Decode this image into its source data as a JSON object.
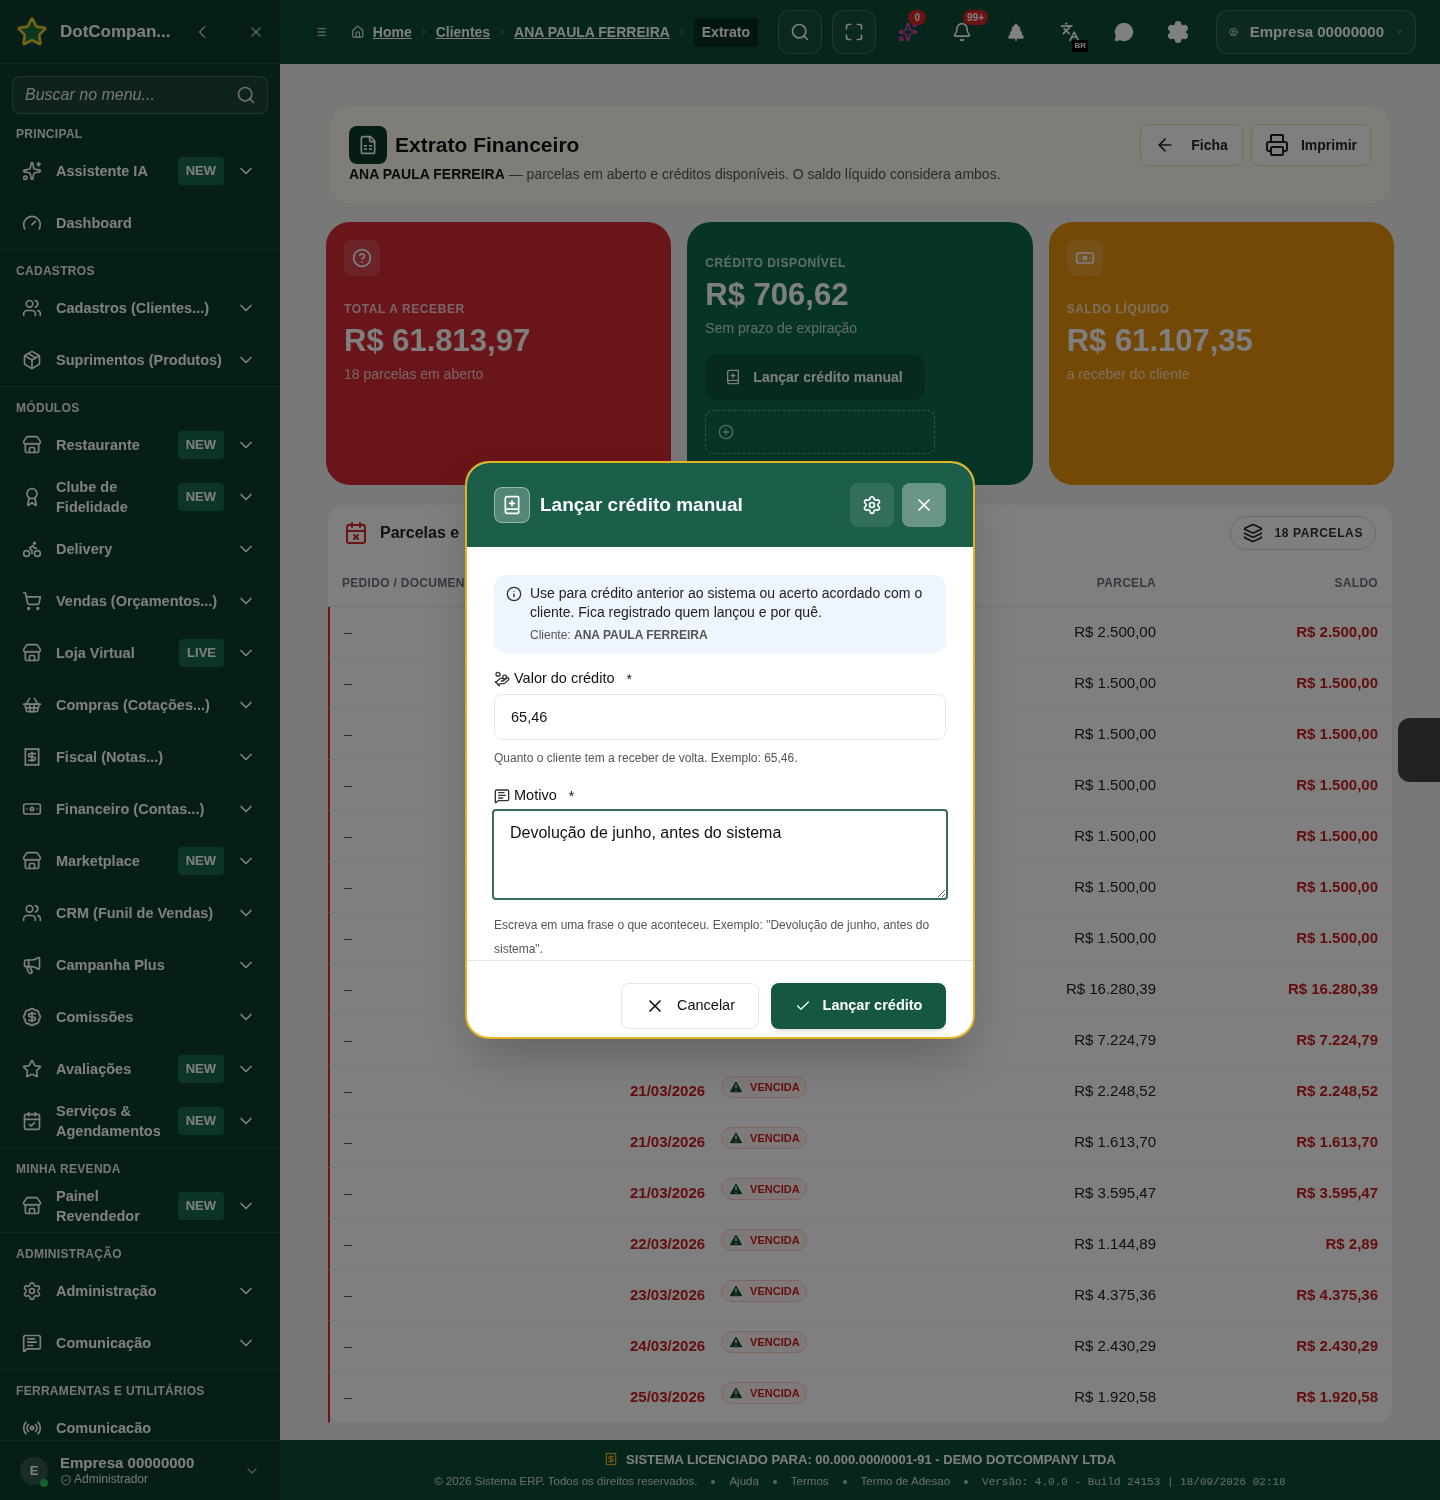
{
  "sidebar": {
    "brand": "DotCompan...",
    "search": {
      "placeholder": "Buscar no menu..."
    },
    "sections": [
      {
        "title": "PRINCIPAL",
        "items": [
          {
            "label": "Assistente IA",
            "badge": "NEW",
            "expandable": true
          },
          {
            "label": "Dashboard",
            "expandable": false
          }
        ]
      },
      {
        "title": "CADASTROS",
        "items": [
          {
            "label": "Cadastros (Clientes...)",
            "expandable": true
          },
          {
            "label": "Suprimentos (Produtos)",
            "expandable": true
          }
        ]
      },
      {
        "title": "MÓDULOS",
        "items": [
          {
            "label": "Restaurante",
            "badge": "NEW",
            "expandable": true
          },
          {
            "label": "Clube de Fidelidade",
            "badge": "NEW",
            "expandable": true
          },
          {
            "label": "Delivery",
            "expandable": true
          },
          {
            "label": "Vendas (Orçamentos...)",
            "expandable": true
          },
          {
            "label": "Loja Virtual",
            "badge": "LIVE",
            "expandable": true
          },
          {
            "label": "Compras (Cotações...)",
            "expandable": true
          },
          {
            "label": "Fiscal (Notas...)",
            "expandable": true
          },
          {
            "label": "Financeiro (Contas...)",
            "expandable": true
          },
          {
            "label": "Marketplace",
            "badge": "NEW",
            "expandable": true
          },
          {
            "label": "CRM (Funil de Vendas)",
            "expandable": true
          },
          {
            "label": "Campanha Plus",
            "expandable": true
          },
          {
            "label": "Comissões",
            "expandable": true
          },
          {
            "label": "Avaliações",
            "badge": "NEW",
            "expandable": true
          },
          {
            "label": "Serviços & Agendamentos",
            "badge": "NEW",
            "expandable": true
          }
        ]
      },
      {
        "title": "MINHA REVENDA",
        "items": [
          {
            "label": "Painel Revendedor",
            "badge": "NEW",
            "expandable": true
          }
        ]
      },
      {
        "title": "ADMINISTRAÇÃO",
        "items": [
          {
            "label": "Administração",
            "expandable": true
          },
          {
            "label": "Comunicação",
            "expandable": true
          }
        ]
      },
      {
        "title": "FERRAMENTAS E UTILITÁRIOS",
        "items": [
          {
            "label": "Comunicacão",
            "expandable": false
          }
        ]
      }
    ],
    "user": {
      "initial": "E",
      "name": "Empresa 00000000",
      "role": "Administrador"
    }
  },
  "topbar": {
    "breadcrumb": [
      {
        "label": "Home",
        "selected": false
      },
      {
        "label": "Clientes",
        "selected": false
      },
      {
        "label": "ANA PAULA FERREIRA",
        "selected": false
      },
      {
        "label": "Extrato",
        "selected": true
      }
    ],
    "ai_badge": "0",
    "notifications_badge": "99+",
    "language_badge": "BR",
    "account": "Empresa 00000000"
  },
  "page_header": {
    "title": "Extrato Financeiro",
    "client": "ANA PAULA FERREIRA",
    "subtitle": "— parcelas em aberto e créditos disponíveis. O saldo líquido considera ambos.",
    "buttons": [
      "Ficha",
      "Imprimir"
    ]
  },
  "cards": [
    {
      "kind": "receivable",
      "label": "TOTAL A RECEBER",
      "value": "R$ 61.813,97",
      "note": "18 parcelas em aberto"
    },
    {
      "kind": "credit",
      "label": "CRÉDITO DISPONÍVEL",
      "value": "R$ 706,62",
      "note": "Sem prazo de expiração",
      "action": "Lançar crédito manual"
    },
    {
      "kind": "net",
      "label": "SALDO LÍQUIDO",
      "value": "R$ 61.107,35",
      "note": "a receber do cliente"
    }
  ],
  "table": {
    "title": "Parcelas e",
    "count": "18 PARCELAS",
    "columns": [
      "PEDIDO / DOCUMEN",
      "PARCELA",
      "SALDO"
    ],
    "rows": [
      {
        "document": "–",
        "installment": "R$ 2.500,00",
        "balance": "R$ 2.500,00"
      },
      {
        "document": "–",
        "installment": "R$ 1.500,00",
        "balance": "R$ 1.500,00"
      },
      {
        "document": "–",
        "installment": "R$ 1.500,00",
        "balance": "R$ 1.500,00"
      },
      {
        "document": "–",
        "installment": "R$ 1.500,00",
        "balance": "R$ 1.500,00"
      },
      {
        "document": "–",
        "installment": "R$ 1.500,00",
        "balance": "R$ 1.500,00"
      },
      {
        "document": "–",
        "installment": "R$ 1.500,00",
        "balance": "R$ 1.500,00"
      },
      {
        "document": "–",
        "installment": "R$ 1.500,00",
        "balance": "R$ 1.500,00"
      },
      {
        "document": "–",
        "installment": "R$ 16.280,39",
        "balance": "R$ 16.280,39"
      },
      {
        "document": "–",
        "installment": "R$ 7.224,79",
        "balance": "R$ 7.224,79"
      },
      {
        "document": "–",
        "date": "21/03/2026",
        "status": "VENCIDA",
        "installment": "R$ 2.248,52",
        "balance": "R$ 2.248,52"
      },
      {
        "document": "–",
        "date": "21/03/2026",
        "status": "VENCIDA",
        "installment": "R$ 1.613,70",
        "balance": "R$ 1.613,70"
      },
      {
        "document": "–",
        "date": "21/03/2026",
        "status": "VENCIDA",
        "installment": "R$ 3.595,47",
        "balance": "R$ 3.595,47"
      },
      {
        "document": "–",
        "date": "22/03/2026",
        "status": "VENCIDA",
        "installment": "R$ 1.144,89",
        "balance": "R$ 2,89"
      },
      {
        "document": "–",
        "date": "23/03/2026",
        "status": "VENCIDA",
        "installment": "R$ 4.375,36",
        "balance": "R$ 4.375,36"
      },
      {
        "document": "–",
        "date": "24/03/2026",
        "status": "VENCIDA",
        "installment": "R$ 2.430,29",
        "balance": "R$ 2.430,29"
      },
      {
        "document": "–",
        "date": "25/03/2026",
        "status": "VENCIDA",
        "installment": "R$ 1.920,58",
        "balance": "R$ 1.920,58"
      }
    ]
  },
  "footer": {
    "license_label": "SISTEMA LICENCIADO PARA:",
    "license_value": "00.000.000/0001-91 - DEMO DOTCOMPANY LTDA",
    "links": [
      "© 2026 Sistema ERP. Todos os direitos reservados.",
      "Ajuda",
      "Termos",
      "Termo de Adesao"
    ],
    "version": "Versão: 4.0.0 - Build 24153 | 18/09/2026 02:18"
  },
  "modal": {
    "title": "Lançar crédito manual",
    "info": "Use para crédito anterior ao sistema ou acerto acordado com o cliente. Fica registrado quem lançou e por quê.",
    "client_label": "Cliente:",
    "client_name": "ANA PAULA FERREIRA",
    "fields": [
      {
        "kind": "input",
        "label": "Valor do crédito",
        "required_mark": "*",
        "value": "65,46",
        "hint": "Quanto o cliente tem a receber de volta. Exemplo: 65,46."
      },
      {
        "kind": "textarea",
        "label": "Motivo",
        "required_mark": "*",
        "value": "Devolução de junho, antes do sistema",
        "hint": "Escreva em uma frase o que aconteceu. Exemplo: \"Devolução de junho, antes do sistema\"."
      }
    ],
    "cancel": "Cancelar",
    "confirm": "Lançar crédito"
  }
}
